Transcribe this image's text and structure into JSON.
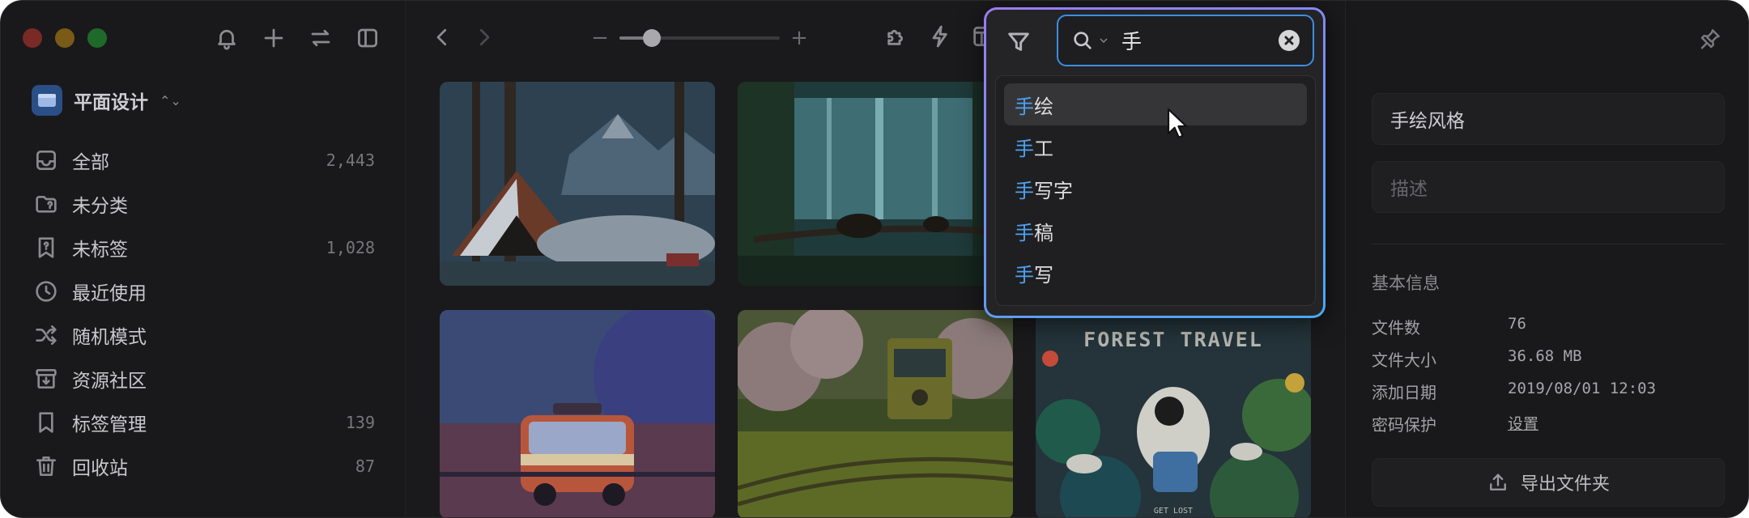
{
  "sidebar": {
    "library_name": "平面设计",
    "items": [
      {
        "label": "全部",
        "count": "2,443"
      },
      {
        "label": "未分类",
        "count": ""
      },
      {
        "label": "未标签",
        "count": "1,028"
      },
      {
        "label": "最近使用",
        "count": ""
      },
      {
        "label": "随机模式",
        "count": ""
      },
      {
        "label": "资源社区",
        "count": ""
      },
      {
        "label": "标签管理",
        "count": "139"
      },
      {
        "label": "回收站",
        "count": "87"
      }
    ]
  },
  "toolbar": {
    "zoom_level": 0.2
  },
  "grid": {
    "items": [
      {
        "text": ""
      },
      {
        "text": ""
      },
      {
        "text": ""
      },
      {
        "text": ""
      },
      {
        "text": ""
      },
      {
        "text": "FOREST TRAVEL",
        "caption": "GET LOST"
      }
    ]
  },
  "search": {
    "query": "手",
    "suggestions": [
      {
        "highlight": "手",
        "rest": "绘"
      },
      {
        "highlight": "手",
        "rest": "工"
      },
      {
        "highlight": "手",
        "rest": "写字"
      },
      {
        "highlight": "手",
        "rest": "稿"
      },
      {
        "highlight": "手",
        "rest": "写"
      }
    ]
  },
  "panel": {
    "name_value": "手绘风格",
    "desc_placeholder": "描述",
    "info_title": "基本信息",
    "info": [
      {
        "key": "文件数",
        "value": "76"
      },
      {
        "key": "文件大小",
        "value": "36.68 MB"
      },
      {
        "key": "添加日期",
        "value": "2019/08/01 12:03"
      },
      {
        "key": "密码保护",
        "value": "设置"
      }
    ],
    "export_label": "导出文件夹"
  },
  "colors": {
    "accent": "#4ea2f2",
    "popover_border_start": "#9c7cf0",
    "popover_border_end": "#4aa8f0"
  }
}
